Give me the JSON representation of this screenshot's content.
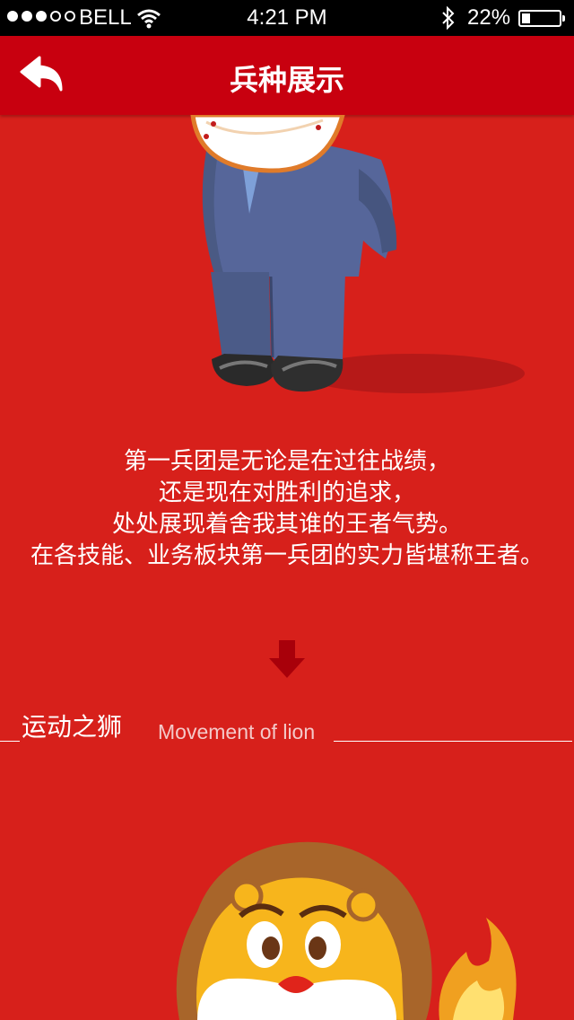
{
  "status_bar": {
    "carrier": "BELL",
    "time": "4:21 PM",
    "battery_percent": "22%",
    "battery_level": 0.22,
    "signal_strength_dots": 3,
    "signal_total_dots": 5
  },
  "nav": {
    "title": "兵种展示",
    "back_icon": "back-arrow-icon"
  },
  "content": {
    "description_lines": [
      "第一兵团是无论是在过往战绩，",
      "还是现在对胜利的追求，",
      "处处展现着舍我其谁的王者气势。",
      "在各技能、业务板块第一兵团的实力皆堪称王者。"
    ],
    "section": {
      "title_cn": "运动之狮",
      "title_en": "Movement of lion"
    }
  },
  "colors": {
    "background": "#d7201b",
    "nav_bar": "#c8000f",
    "arrow": "#a8000a"
  }
}
